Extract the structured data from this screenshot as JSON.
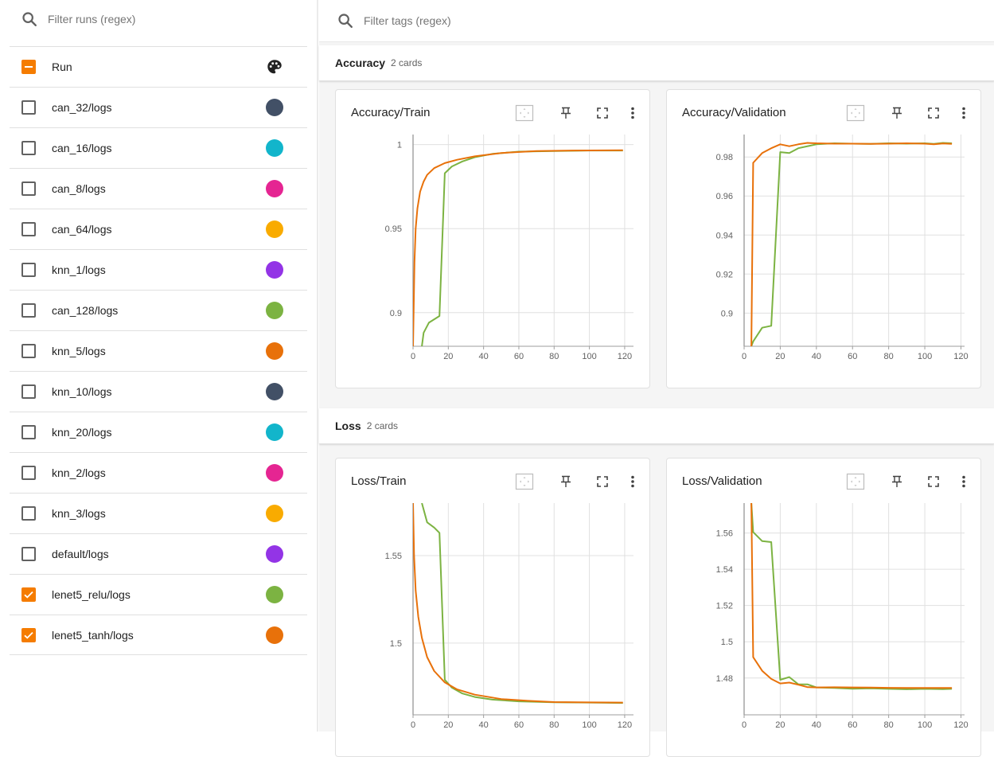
{
  "sidebar": {
    "filter_placeholder": "Filter runs (regex)",
    "header_label": "Run",
    "runs": [
      {
        "name": "can_32/logs",
        "color": "#425066",
        "checked": false
      },
      {
        "name": "can_16/logs",
        "color": "#12b5cb",
        "checked": false
      },
      {
        "name": "can_8/logs",
        "color": "#e52592",
        "checked": false
      },
      {
        "name": "can_64/logs",
        "color": "#f9ab00",
        "checked": false
      },
      {
        "name": "knn_1/logs",
        "color": "#9334e6",
        "checked": false
      },
      {
        "name": "can_128/logs",
        "color": "#7cb342",
        "checked": false
      },
      {
        "name": "knn_5/logs",
        "color": "#e8710a",
        "checked": false
      },
      {
        "name": "knn_10/logs",
        "color": "#425066",
        "checked": false
      },
      {
        "name": "knn_20/logs",
        "color": "#12b5cb",
        "checked": false
      },
      {
        "name": "knn_2/logs",
        "color": "#e52592",
        "checked": false
      },
      {
        "name": "knn_3/logs",
        "color": "#f9ab00",
        "checked": false
      },
      {
        "name": "default/logs",
        "color": "#9334e6",
        "checked": false
      },
      {
        "name": "lenet5_relu/logs",
        "color": "#7cb342",
        "checked": true
      },
      {
        "name": "lenet5_tanh/logs",
        "color": "#e8710a",
        "checked": true
      }
    ]
  },
  "main": {
    "filter_placeholder": "Filter tags (regex)",
    "groups": [
      {
        "title": "Accuracy",
        "count": "2 cards"
      },
      {
        "title": "Loss",
        "count": "2 cards"
      }
    ]
  },
  "colors": {
    "accent": "#f57c00",
    "relu": "#7cb342",
    "tanh": "#e8710a"
  },
  "icons": [
    "search-icon",
    "palette-icon",
    "fit-domain-icon",
    "pin-icon",
    "fullscreen-icon",
    "more-vert-icon"
  ],
  "chart_data": [
    {
      "type": "line",
      "title": "Accuracy/Train",
      "xlim": [
        0,
        125
      ],
      "ylim": [
        0.88,
        1.006
      ],
      "xticks": [
        "0",
        "20",
        "40",
        "60",
        "80",
        "100",
        "120"
      ],
      "yticks": [
        "0.9",
        "0.95",
        "1"
      ],
      "ytick_values": [
        0.9,
        0.95,
        1.0
      ],
      "series": [
        {
          "name": "lenet5_relu/logs",
          "color": "#7cb342",
          "points": [
            [
              5,
              0.88
            ],
            [
              6,
              0.888
            ],
            [
              9,
              0.894
            ],
            [
              15,
              0.898
            ],
            [
              18,
              0.983
            ],
            [
              22,
              0.987
            ],
            [
              28,
              0.99
            ],
            [
              35,
              0.9925
            ],
            [
              45,
              0.9945
            ],
            [
              60,
              0.9958
            ],
            [
              80,
              0.9962
            ],
            [
              100,
              0.9965
            ],
            [
              119,
              0.9965
            ]
          ]
        },
        {
          "name": "lenet5_tanh/logs",
          "color": "#e8710a",
          "points": [
            [
              0,
              0.88
            ],
            [
              0.8,
              0.93
            ],
            [
              1.5,
              0.95
            ],
            [
              2.5,
              0.962
            ],
            [
              4,
              0.972
            ],
            [
              6,
              0.978
            ],
            [
              8,
              0.982
            ],
            [
              12,
              0.986
            ],
            [
              18,
              0.989
            ],
            [
              25,
              0.991
            ],
            [
              35,
              0.993
            ],
            [
              50,
              0.995
            ],
            [
              70,
              0.9962
            ],
            [
              90,
              0.9965
            ],
            [
              119,
              0.9966
            ]
          ]
        }
      ]
    },
    {
      "type": "line",
      "title": "Accuracy/Validation",
      "xlim": [
        0,
        122
      ],
      "ylim": [
        0.883,
        0.9915
      ],
      "xticks": [
        "0",
        "20",
        "40",
        "60",
        "80",
        "100",
        "120"
      ],
      "yticks": [
        "0.9",
        "0.92",
        "0.94",
        "0.96",
        "0.98"
      ],
      "ytick_values": [
        0.9,
        0.92,
        0.94,
        0.96,
        0.98
      ],
      "series": [
        {
          "name": "lenet5_relu/logs",
          "color": "#7cb342",
          "points": [
            [
              4,
              0.883
            ],
            [
              5,
              0.8855
            ],
            [
              10,
              0.8925
            ],
            [
              15,
              0.8935
            ],
            [
              20,
              0.9825
            ],
            [
              25,
              0.982
            ],
            [
              30,
              0.9845
            ],
            [
              40,
              0.9865
            ],
            [
              50,
              0.987
            ],
            [
              60,
              0.9868
            ],
            [
              70,
              0.9867
            ],
            [
              80,
              0.987
            ],
            [
              90,
              0.9868
            ],
            [
              100,
              0.987
            ],
            [
              105,
              0.9867
            ],
            [
              110,
              0.9872
            ],
            [
              115,
              0.987
            ]
          ]
        },
        {
          "name": "lenet5_tanh/logs",
          "color": "#e8710a",
          "points": [
            [
              4,
              0.883
            ],
            [
              5,
              0.977
            ],
            [
              10,
              0.982
            ],
            [
              15,
              0.9845
            ],
            [
              20,
              0.9865
            ],
            [
              25,
              0.9855
            ],
            [
              30,
              0.9865
            ],
            [
              35,
              0.9872
            ],
            [
              40,
              0.987
            ],
            [
              50,
              0.9868
            ],
            [
              60,
              0.9868
            ],
            [
              70,
              0.9867
            ],
            [
              80,
              0.9868
            ],
            [
              90,
              0.987
            ],
            [
              100,
              0.9868
            ],
            [
              105,
              0.9865
            ],
            [
              110,
              0.9869
            ],
            [
              115,
              0.9867
            ]
          ]
        }
      ]
    },
    {
      "type": "line",
      "title": "Loss/Train",
      "xlim": [
        0,
        125
      ],
      "ylim": [
        1.459,
        1.58
      ],
      "xticks": [
        "0",
        "20",
        "40",
        "60",
        "80",
        "100",
        "120"
      ],
      "yticks": [
        "1.5",
        "1.55"
      ],
      "ytick_values": [
        1.5,
        1.55
      ],
      "series": [
        {
          "name": "lenet5_relu/logs",
          "color": "#7cb342",
          "points": [
            [
              5,
              1.58
            ],
            [
              8,
              1.569
            ],
            [
              12,
              1.566
            ],
            [
              15,
              1.563
            ],
            [
              18,
              1.479
            ],
            [
              22,
              1.4745
            ],
            [
              28,
              1.4712
            ],
            [
              35,
              1.4692
            ],
            [
              45,
              1.4677
            ],
            [
              60,
              1.4667
            ],
            [
              80,
              1.4662
            ],
            [
              100,
              1.466
            ],
            [
              119,
              1.4658
            ]
          ]
        },
        {
          "name": "lenet5_tanh/logs",
          "color": "#e8710a",
          "points": [
            [
              0,
              1.58
            ],
            [
              0.6,
              1.55
            ],
            [
              1.5,
              1.53
            ],
            [
              3,
              1.515
            ],
            [
              5,
              1.503
            ],
            [
              8,
              1.492
            ],
            [
              12,
              1.484
            ],
            [
              18,
              1.4775
            ],
            [
              25,
              1.4735
            ],
            [
              35,
              1.4705
            ],
            [
              50,
              1.468
            ],
            [
              65,
              1.467
            ],
            [
              80,
              1.4663
            ],
            [
              100,
              1.4661
            ],
            [
              119,
              1.466
            ]
          ]
        }
      ]
    },
    {
      "type": "line",
      "title": "Loss/Validation",
      "xlim": [
        0,
        122
      ],
      "ylim": [
        1.4597,
        1.5765
      ],
      "xticks": [
        "0",
        "20",
        "40",
        "60",
        "80",
        "100",
        "120"
      ],
      "yticks": [
        "1.48",
        "1.5",
        "1.52",
        "1.54",
        "1.56"
      ],
      "ytick_values": [
        1.48,
        1.5,
        1.52,
        1.54,
        1.56
      ],
      "series": [
        {
          "name": "lenet5_relu/logs",
          "color": "#7cb342",
          "points": [
            [
              4,
              1.5765
            ],
            [
              5,
              1.5605
            ],
            [
              10,
              1.5555
            ],
            [
              15,
              1.555
            ],
            [
              20,
              1.479
            ],
            [
              25,
              1.4805
            ],
            [
              30,
              1.4765
            ],
            [
              35,
              1.4765
            ],
            [
              40,
              1.4748
            ],
            [
              50,
              1.4745
            ],
            [
              60,
              1.4741
            ],
            [
              70,
              1.4743
            ],
            [
              80,
              1.474
            ],
            [
              90,
              1.4738
            ],
            [
              100,
              1.474
            ],
            [
              110,
              1.4739
            ],
            [
              115,
              1.474
            ]
          ]
        },
        {
          "name": "lenet5_tanh/logs",
          "color": "#e8710a",
          "points": [
            [
              4,
              1.5765
            ],
            [
              5,
              1.4915
            ],
            [
              10,
              1.484
            ],
            [
              15,
              1.4795
            ],
            [
              20,
              1.477
            ],
            [
              25,
              1.4775
            ],
            [
              30,
              1.4763
            ],
            [
              35,
              1.475
            ],
            [
              40,
              1.4748
            ],
            [
              50,
              1.4749
            ],
            [
              60,
              1.4748
            ],
            [
              70,
              1.4747
            ],
            [
              80,
              1.4746
            ],
            [
              90,
              1.4745
            ],
            [
              100,
              1.4745
            ],
            [
              110,
              1.4745
            ],
            [
              115,
              1.4745
            ]
          ]
        }
      ]
    }
  ]
}
